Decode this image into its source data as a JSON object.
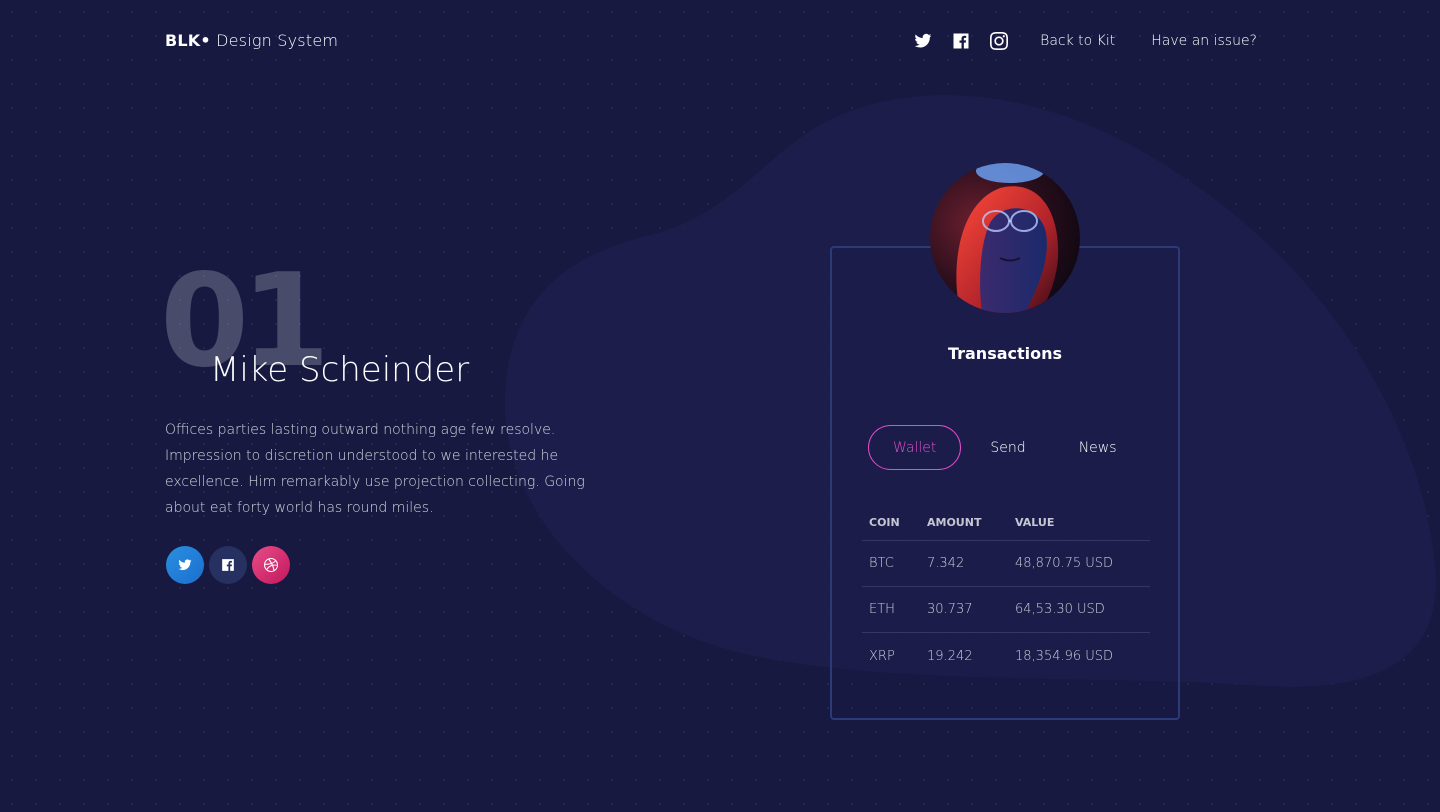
{
  "navbar": {
    "brand_bold": "BLK•",
    "brand_rest": " Design System",
    "icons": [
      "twitter-icon",
      "facebook-icon",
      "instagram-icon"
    ],
    "links": [
      "Back to Kit",
      "Have an issue?"
    ]
  },
  "profile": {
    "number": "01",
    "name": "Mike Scheinder",
    "description": "Offices parties lasting outward nothing age few resolve. Impression to discretion understood to we interested he excellence. Him remarkably use projection collecting. Going about eat forty world has round miles.",
    "socials": [
      "twitter-icon",
      "facebook-icon",
      "dribbble-icon"
    ]
  },
  "card": {
    "title": "Transactions",
    "tabs": [
      "Wallet",
      "Send",
      "News"
    ],
    "active_tab": "Wallet",
    "columns": [
      "COIN",
      "AMOUNT",
      "VALUE"
    ],
    "rows": [
      {
        "coin": "BTC",
        "amount": "7.342",
        "value": "48,870.75 USD"
      },
      {
        "coin": "ETH",
        "amount": "30.737",
        "value": "64,53.30 USD"
      },
      {
        "coin": "XRP",
        "amount": "19.242",
        "value": "18,354.96 USD"
      }
    ]
  },
  "colors": {
    "background": "#171941",
    "accent": "#e14eca",
    "card_border": "#2d3a78",
    "twitter": "#1d8ce0",
    "facebook": "#263061",
    "dribbble": "#ea4c89"
  }
}
